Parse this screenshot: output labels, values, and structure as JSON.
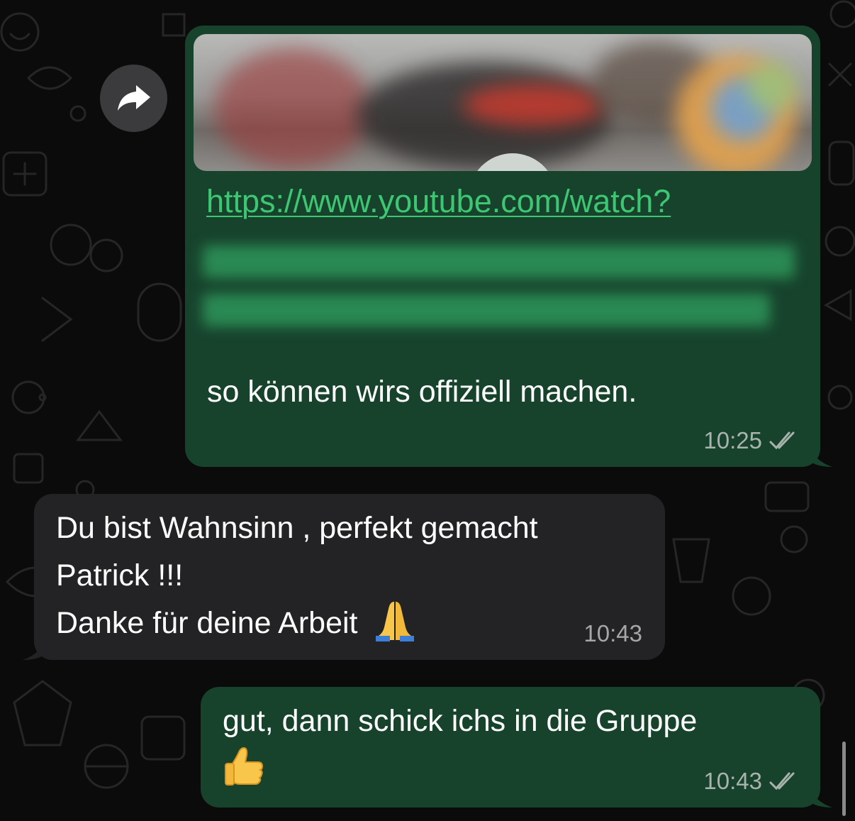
{
  "messages": [
    {
      "direction": "outgoing",
      "link_preview": {
        "url_text": "https://www.youtube.com/watch?"
      },
      "text": "so können wirs offiziell machen.",
      "time": "10:25",
      "status": "read-double-check-icon"
    },
    {
      "direction": "incoming",
      "lines": [
        "Du bist Wahnsinn , perfekt gemacht",
        "Patrick !!!",
        "Danke für deine Arbeit"
      ],
      "emoji": "folded-hands",
      "time": "10:43"
    },
    {
      "direction": "outgoing",
      "text": "gut, dann schick ichs in die Gruppe",
      "emoji": "thumbs-up",
      "time": "10:43",
      "status": "read-double-check-icon"
    }
  ],
  "colors": {
    "background": "#0b0b0b",
    "outgoing_bubble": "#17432d",
    "incoming_bubble": "#232325",
    "link": "#3ec773"
  },
  "icons": {
    "forward": "forward-arrow-icon",
    "read_receipt": "double-check-icon"
  }
}
